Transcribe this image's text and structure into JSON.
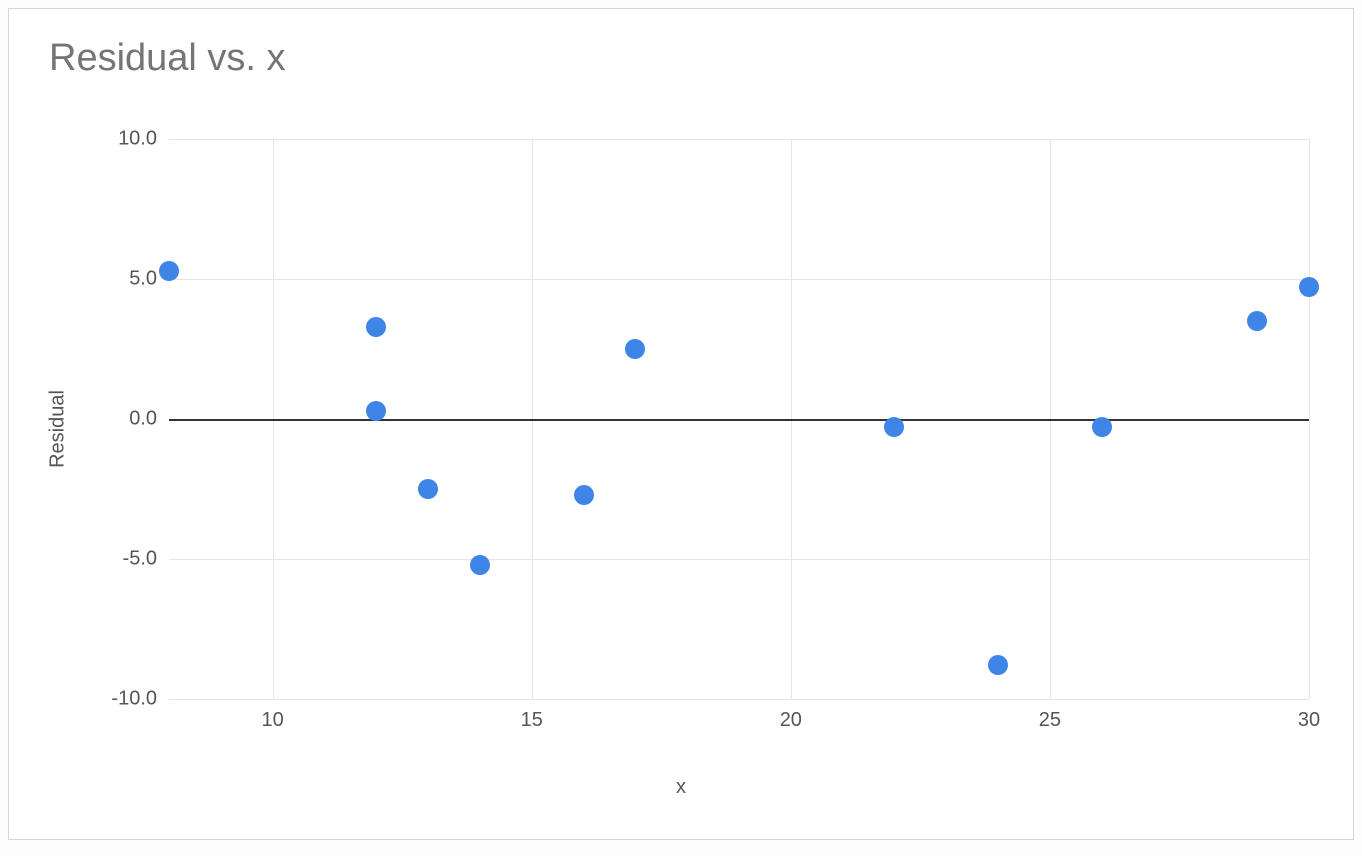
{
  "chart_data": {
    "type": "scatter",
    "title": "Residual vs. x",
    "xlabel": "x",
    "ylabel": "Residual",
    "xlim": [
      8,
      30
    ],
    "ylim": [
      -10,
      10
    ],
    "x_ticks": [
      10,
      15,
      20,
      25,
      30
    ],
    "y_ticks": [
      -10.0,
      -5.0,
      0.0,
      5.0,
      10.0
    ],
    "y_tick_labels": [
      "-10.0",
      "-5.0",
      "0.0",
      "5.0",
      "10.0"
    ],
    "x": [
      8,
      12,
      12,
      13,
      14,
      16,
      17,
      22,
      24,
      26,
      29,
      30
    ],
    "y": [
      5.3,
      3.3,
      0.3,
      -2.5,
      -5.2,
      -2.7,
      2.5,
      -0.3,
      -8.8,
      -0.3,
      3.5,
      4.7
    ],
    "point_color": "#3f85e8",
    "grid": true
  }
}
